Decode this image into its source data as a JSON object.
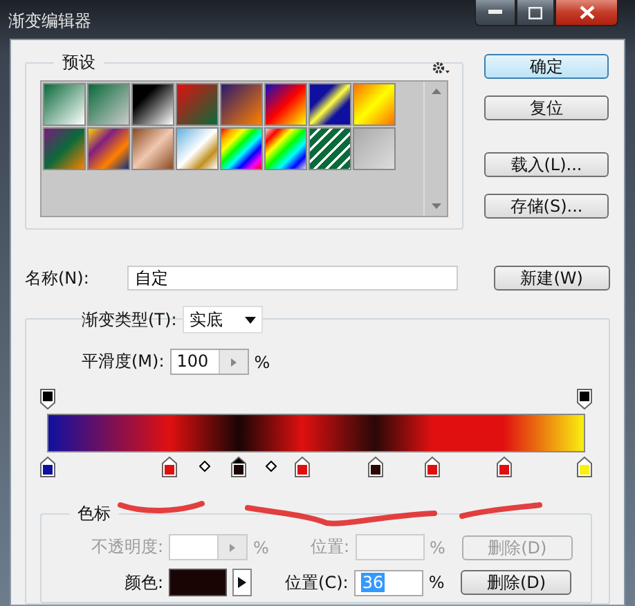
{
  "window": {
    "title": "渐变编辑器"
  },
  "presets": {
    "title": "预设"
  },
  "buttons": [
    {
      "label": "确定",
      "kind": "default"
    },
    {
      "label": "复位",
      "kind": "normal"
    },
    {
      "label": "载入(L)...",
      "kind": "normal"
    },
    {
      "label": "存储(S)...",
      "kind": "normal"
    }
  ],
  "name": {
    "label": "名称(N):",
    "value": "自定",
    "button": "新建(W)"
  },
  "gradient_type": {
    "label": "渐变类型(T):",
    "value": "实底"
  },
  "smoothness": {
    "label": "平滑度(M):",
    "value": "100",
    "unit": "%"
  },
  "opacity_stops": [
    {
      "level": 0,
      "color": "#000000"
    },
    {
      "level": 1,
      "color": "#000000"
    }
  ],
  "color_stops": [
    {
      "level": 0,
      "color": "#1010a0",
      "selected": false
    },
    {
      "level": 0.227,
      "color": "#e01010",
      "selected": false
    },
    {
      "level": 0.356,
      "color": "#1a0505",
      "selected": true
    },
    {
      "level": 0.474,
      "color": "#e01010",
      "selected": false
    },
    {
      "level": 0.61,
      "color": "#2a0808",
      "selected": false
    },
    {
      "level": 0.716,
      "color": "#e01010",
      "selected": false
    },
    {
      "level": 0.85,
      "color": "#e01010",
      "selected": false
    },
    {
      "level": 1,
      "color": "#f8f010",
      "selected": false
    }
  ],
  "stops_group": {
    "title": "色标",
    "opacity_row": {
      "label": "不透明度:",
      "unit": "%",
      "location_label": "位置:",
      "location_unit": "%",
      "delete": "删除(D)",
      "disabled": true
    },
    "color_row": {
      "label": "颜色:",
      "location_label": "位置(C):",
      "location_value": "36",
      "location_unit": "%",
      "delete": "删除(D)",
      "disabled": false
    }
  }
}
